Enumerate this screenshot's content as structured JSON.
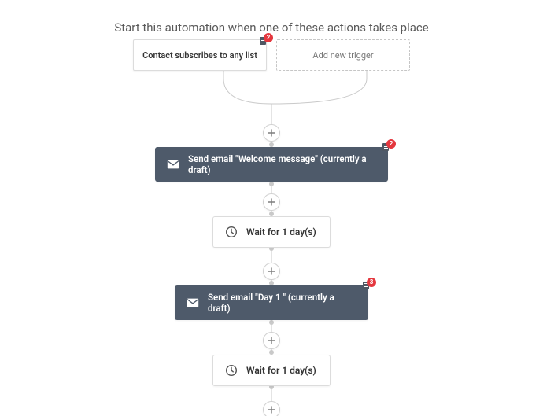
{
  "header": "Start this automation when one of these actions takes place",
  "triggers": {
    "existing": {
      "label": "Contact subscribes to any list",
      "badge": "2"
    },
    "add": {
      "label": "Add new trigger"
    }
  },
  "steps": {
    "email1": {
      "label": "Send email \"Welcome message\" (currently a draft)",
      "badge": "2"
    },
    "wait1": {
      "label": "Wait for 1 day(s)"
    },
    "email2": {
      "label": "Send email \"Day 1 \" (currently a draft)",
      "badge": "3"
    },
    "wait2": {
      "label": "Wait for 1 day(s)"
    }
  }
}
